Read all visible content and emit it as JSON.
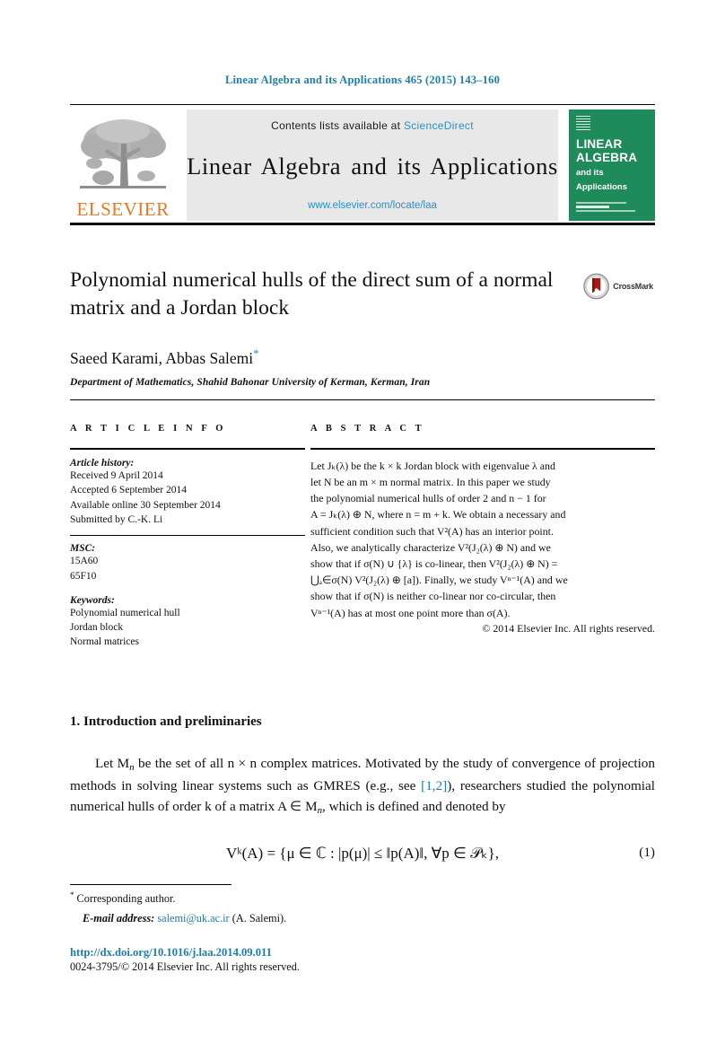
{
  "running_head": "Linear Algebra and its Applications 465 (2015) 143–160",
  "masthead": {
    "contents_prefix": "Contents lists available at",
    "sciencedirect_label": "ScienceDirect",
    "journal_name": "Linear Algebra and its Applications",
    "journal_url": "www.elsevier.com/locate/laa",
    "publisher_wordmark": "ELSEVIER",
    "cover": {
      "line1": "LINEAR",
      "line2": "ALGEBRA",
      "line3": "and its",
      "line4": "Applications"
    },
    "colors": {
      "link": "#2a8fc4",
      "band_background": "#e8e8e8",
      "cover_green": "#1f8a5a",
      "elsevier_orange": "#e87722"
    }
  },
  "article": {
    "title": "Polynomial numerical hulls of the direct sum of a normal matrix and a Jordan block",
    "authors": "Saeed Karami, Abbas Salemi",
    "corresponding_marker": "*",
    "affiliation": "Department of Mathematics, Shahid Bahonar University of Kerman, Kerman, Iran",
    "crossmark_label": "CrossMark"
  },
  "article_info": {
    "heading": "A R T I C L E   I N F O",
    "history_label": "Article history:",
    "history": [
      "Received 9 April 2014",
      "Accepted 6 September 2014",
      "Available online 30 September 2014",
      "Submitted by C.-K. Li"
    ],
    "msc_label": "MSC:",
    "msc": [
      "15A60",
      "65F10"
    ],
    "keywords_label": "Keywords:",
    "keywords": [
      "Polynomial numerical hull",
      "Jordan block",
      "Normal matrices"
    ]
  },
  "abstract": {
    "heading": "A B S T R A C T",
    "lines": [
      "Let Jₖ(λ) be the k × k Jordan block with eigenvalue λ and",
      "let N be an m × m normal matrix. In this paper we study",
      "the polynomial numerical hulls of order 2 and n − 1 for",
      "A = Jₖ(λ) ⊕ N, where n = m + k. We obtain a necessary and",
      "sufficient condition such that V²(A) has an interior point.",
      "Also, we analytically characterize V²(J₂(λ) ⊕ N) and we",
      "show that if σ(N) ∪ {λ} is co-linear, then V²(J₂(λ) ⊕ N) =",
      "⋃ₐ∈σ(N) V²(J₂(λ) ⊕ [a]). Finally, we study Vⁿ⁻¹(A) and we",
      "show that if σ(N) is neither co-linear nor co-circular, then",
      "Vⁿ⁻¹(A) has at most one point more than σ(A)."
    ],
    "copyright": "© 2014 Elsevier Inc. All rights reserved."
  },
  "body": {
    "section_number_title": "1. Introduction and preliminaries",
    "paragraph_1_parts": {
      "a": "Let M",
      "a_sub": "n",
      "b": " be the set of all n × n complex matrices. Motivated by the study of convergence of projection methods in solving linear systems such as GMRES (e.g., see ",
      "ref": "[1,2]",
      "c": "), researchers studied the polynomial numerical hulls of order k of a matrix A ∈ M",
      "c_sub": "n",
      "d": ", which is defined and denoted by"
    },
    "equation": "Vᵏ(A) = {μ ∈ ℂ : |p(μ)| ≤ ‖p(A)‖, ∀p ∈ 𝒫ₖ},",
    "equation_number": "(1)"
  },
  "footnotes": {
    "corresponding_star": "*",
    "corresponding_text": "Corresponding author.",
    "email_label": "E-mail address:",
    "email": "salemi@uk.ac.ir",
    "email_suffix": "(A. Salemi).",
    "doi": "http://dx.doi.org/10.1016/j.laa.2014.09.011",
    "issn_line": "0024-3795/© 2014 Elsevier Inc. All rights reserved."
  }
}
